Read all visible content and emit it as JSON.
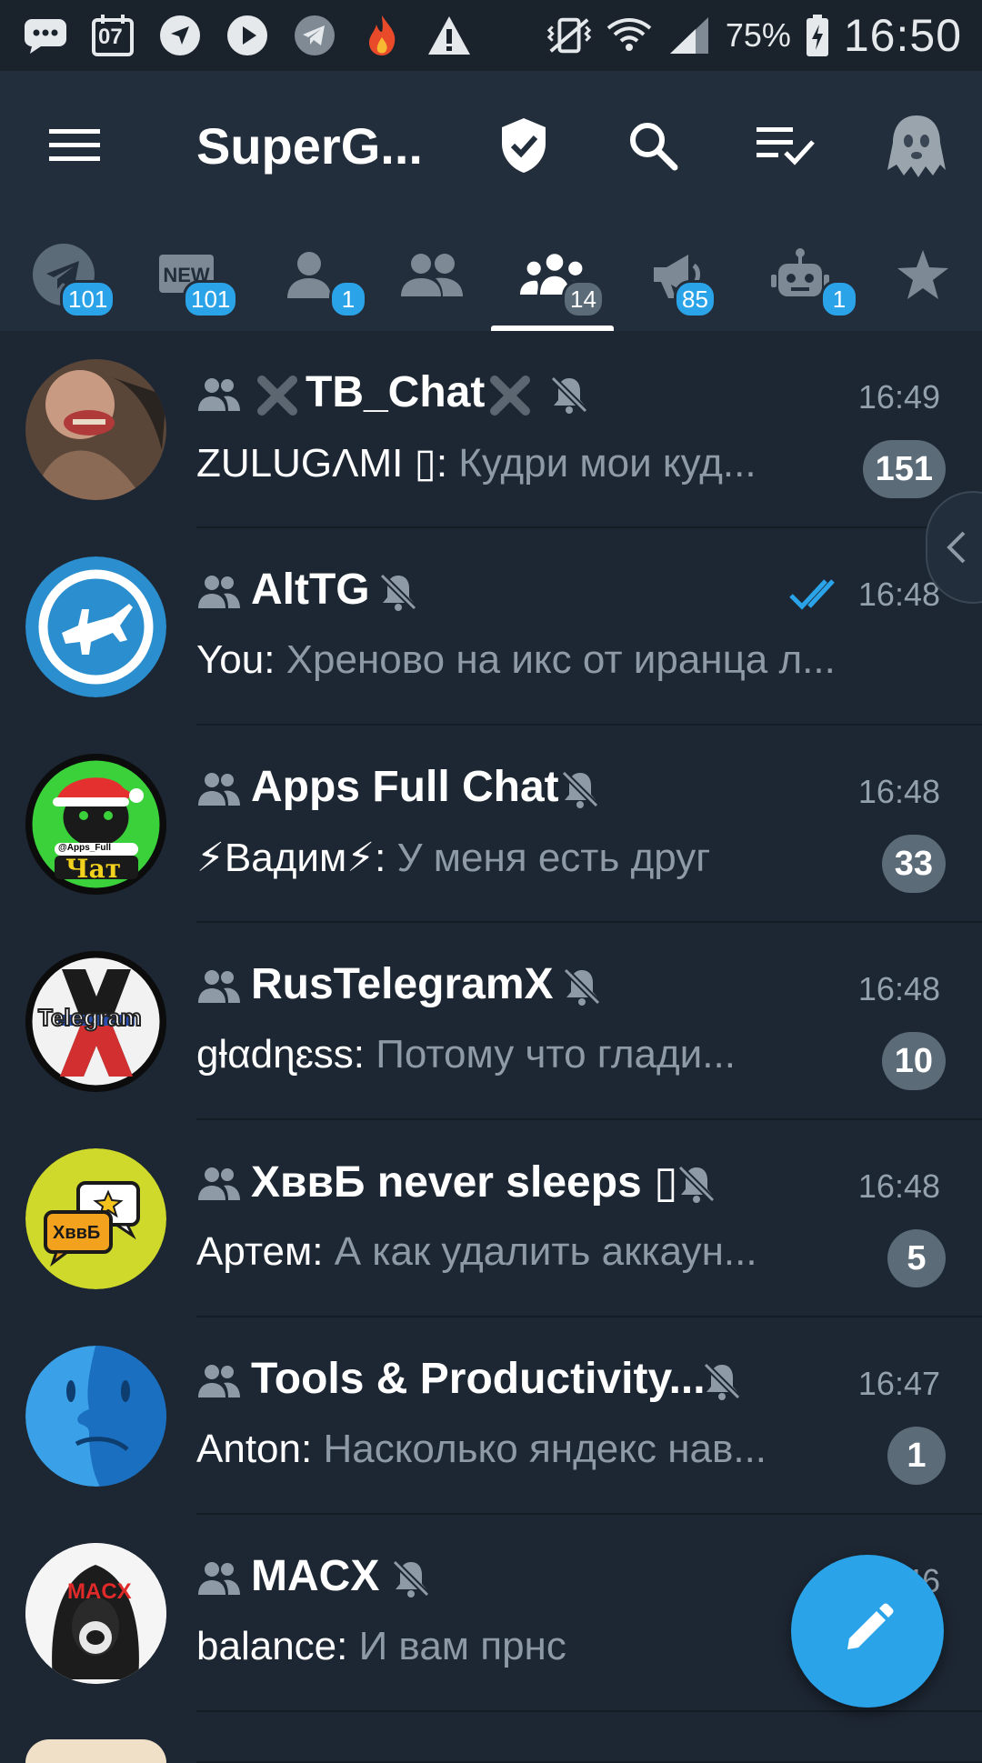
{
  "status_bar": {
    "date_icon_text": "07",
    "battery_percent": "75%",
    "time": "16:50",
    "icons": [
      "messages-icon",
      "calendar-icon",
      "navigation-icon",
      "play-icon",
      "telegram-icon",
      "flame-icon",
      "warning-icon",
      "vibrate-icon",
      "wifi-icon",
      "signal-icon",
      "battery-icon"
    ]
  },
  "app_bar": {
    "title": "SuperG...",
    "icons": [
      "menu-icon",
      "shield-check-icon",
      "search-icon",
      "mark-read-icon",
      "ghost-icon"
    ]
  },
  "tabs": {
    "items": [
      {
        "icon": "telegram-icon",
        "badge": "101"
      },
      {
        "icon": "new-icon",
        "badge": "101"
      },
      {
        "icon": "user-icon",
        "badge": "1"
      },
      {
        "icon": "contacts-icon",
        "badge": ""
      },
      {
        "icon": "groups-icon",
        "badge": "14"
      },
      {
        "icon": "megaphone-icon",
        "badge": "85"
      },
      {
        "icon": "bot-icon",
        "badge": "1"
      },
      {
        "icon": "star-icon",
        "badge": ""
      }
    ],
    "active_index": 4
  },
  "chats": [
    {
      "name": "TB_Chat",
      "time": "16:49",
      "sender": "ZULUGΛMI ▯:",
      "message": " Кудри мои куд...",
      "unread": "151",
      "muted": true
    },
    {
      "name": "AltTG",
      "time": "16:48",
      "sender": "You:",
      "message": " Хреново на икс от иранца л...",
      "unread": "",
      "muted": true,
      "read_checks": true
    },
    {
      "name": "Apps Full Chat",
      "time": "16:48",
      "sender": "⚡Вадим⚡:",
      "message": " У меня есть друг",
      "unread": "33",
      "muted": true
    },
    {
      "name": "RusTelegramX",
      "time": "16:48",
      "sender": "gƚαdɳɛss:",
      "message": " Потому что глади...",
      "unread": "10",
      "muted": true
    },
    {
      "name": "ХввБ never sleeps ▯",
      "time": "16:48",
      "sender": "Артем:",
      "message": " А как удалить аккаун...",
      "unread": "5",
      "muted": true
    },
    {
      "name": "Tools & Productivity...",
      "time": "16:47",
      "sender": "Anton:",
      "message": " Насколько яндекс нав...",
      "unread": "1",
      "muted": true
    },
    {
      "name": "MACX",
      "time": "16:46",
      "sender": "balance:",
      "message": " И вам прнс",
      "unread": "",
      "muted": true
    }
  ],
  "avatar_labels": {
    "apps_full_handle": "@Apps_Full",
    "apps_full_word": "Чат",
    "rustg_word": "Telegram",
    "xvvb_word": "ХввБ",
    "macx_word": "MACX"
  },
  "colors": {
    "background": "#1d2733",
    "header": "#232e3c",
    "accent": "#2aa3e8",
    "badge_muted": "#5c6b78"
  }
}
